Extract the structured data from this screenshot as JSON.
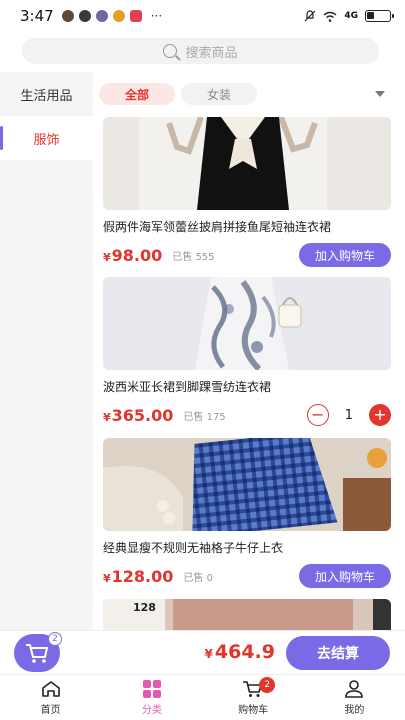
{
  "status": {
    "time": "3:47",
    "more": "···",
    "signal_text": "4G"
  },
  "search": {
    "placeholder": "搜索商品"
  },
  "sidebar": {
    "items": [
      {
        "label": "生活用品",
        "active": false
      },
      {
        "label": "服饰",
        "active": true
      }
    ]
  },
  "tabs": [
    {
      "label": "全部",
      "active": true
    },
    {
      "label": "女装",
      "active": false
    }
  ],
  "products": [
    {
      "title": "假两件海军领蕾丝披肩拼接鱼尾短袖连衣裙",
      "currency": "¥",
      "price": "98.00",
      "sold": "已售 555",
      "action": "加入购物车"
    },
    {
      "title": "波西米亚长裙到脚踝雪纺连衣裙",
      "currency": "¥",
      "price": "365.00",
      "sold": "已售 175",
      "quantity": "1"
    },
    {
      "title": "经典显瘦不规则无袖格子牛仔上衣",
      "currency": "¥",
      "price": "128.00",
      "sold": "已售 0",
      "action": "加入购物车"
    },
    {
      "image_text": "128"
    }
  ],
  "cart_bar": {
    "badge": "2",
    "currency": "¥",
    "total": "464.9",
    "checkout": "去结算"
  },
  "tabbar": [
    {
      "label": "首页",
      "icon": "home-icon"
    },
    {
      "label": "分类",
      "icon": "category-icon",
      "active": true
    },
    {
      "label": "购物车",
      "icon": "cart-icon",
      "badge": "2"
    },
    {
      "label": "我的",
      "icon": "user-icon"
    }
  ],
  "colors": {
    "accent": "#7b6ae6",
    "price": "#e2352c",
    "active_tab": "#e25bb0"
  }
}
